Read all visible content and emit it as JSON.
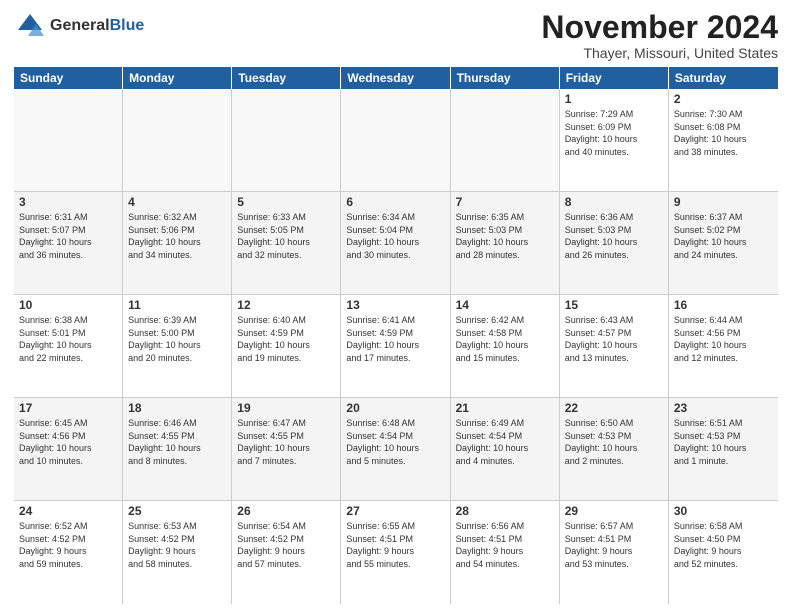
{
  "logo": {
    "general": "General",
    "blue": "Blue"
  },
  "title": "November 2024",
  "location": "Thayer, Missouri, United States",
  "weekdays": [
    "Sunday",
    "Monday",
    "Tuesday",
    "Wednesday",
    "Thursday",
    "Friday",
    "Saturday"
  ],
  "weeks": [
    [
      {
        "day": "",
        "info": "",
        "empty": true
      },
      {
        "day": "",
        "info": "",
        "empty": true
      },
      {
        "day": "",
        "info": "",
        "empty": true
      },
      {
        "day": "",
        "info": "",
        "empty": true
      },
      {
        "day": "",
        "info": "",
        "empty": true
      },
      {
        "day": "1",
        "info": "Sunrise: 7:29 AM\nSunset: 6:09 PM\nDaylight: 10 hours\nand 40 minutes."
      },
      {
        "day": "2",
        "info": "Sunrise: 7:30 AM\nSunset: 6:08 PM\nDaylight: 10 hours\nand 38 minutes."
      }
    ],
    [
      {
        "day": "3",
        "info": "Sunrise: 6:31 AM\nSunset: 5:07 PM\nDaylight: 10 hours\nand 36 minutes."
      },
      {
        "day": "4",
        "info": "Sunrise: 6:32 AM\nSunset: 5:06 PM\nDaylight: 10 hours\nand 34 minutes."
      },
      {
        "day": "5",
        "info": "Sunrise: 6:33 AM\nSunset: 5:05 PM\nDaylight: 10 hours\nand 32 minutes."
      },
      {
        "day": "6",
        "info": "Sunrise: 6:34 AM\nSunset: 5:04 PM\nDaylight: 10 hours\nand 30 minutes."
      },
      {
        "day": "7",
        "info": "Sunrise: 6:35 AM\nSunset: 5:03 PM\nDaylight: 10 hours\nand 28 minutes."
      },
      {
        "day": "8",
        "info": "Sunrise: 6:36 AM\nSunset: 5:03 PM\nDaylight: 10 hours\nand 26 minutes."
      },
      {
        "day": "9",
        "info": "Sunrise: 6:37 AM\nSunset: 5:02 PM\nDaylight: 10 hours\nand 24 minutes."
      }
    ],
    [
      {
        "day": "10",
        "info": "Sunrise: 6:38 AM\nSunset: 5:01 PM\nDaylight: 10 hours\nand 22 minutes."
      },
      {
        "day": "11",
        "info": "Sunrise: 6:39 AM\nSunset: 5:00 PM\nDaylight: 10 hours\nand 20 minutes."
      },
      {
        "day": "12",
        "info": "Sunrise: 6:40 AM\nSunset: 4:59 PM\nDaylight: 10 hours\nand 19 minutes."
      },
      {
        "day": "13",
        "info": "Sunrise: 6:41 AM\nSunset: 4:59 PM\nDaylight: 10 hours\nand 17 minutes."
      },
      {
        "day": "14",
        "info": "Sunrise: 6:42 AM\nSunset: 4:58 PM\nDaylight: 10 hours\nand 15 minutes."
      },
      {
        "day": "15",
        "info": "Sunrise: 6:43 AM\nSunset: 4:57 PM\nDaylight: 10 hours\nand 13 minutes."
      },
      {
        "day": "16",
        "info": "Sunrise: 6:44 AM\nSunset: 4:56 PM\nDaylight: 10 hours\nand 12 minutes."
      }
    ],
    [
      {
        "day": "17",
        "info": "Sunrise: 6:45 AM\nSunset: 4:56 PM\nDaylight: 10 hours\nand 10 minutes."
      },
      {
        "day": "18",
        "info": "Sunrise: 6:46 AM\nSunset: 4:55 PM\nDaylight: 10 hours\nand 8 minutes."
      },
      {
        "day": "19",
        "info": "Sunrise: 6:47 AM\nSunset: 4:55 PM\nDaylight: 10 hours\nand 7 minutes."
      },
      {
        "day": "20",
        "info": "Sunrise: 6:48 AM\nSunset: 4:54 PM\nDaylight: 10 hours\nand 5 minutes."
      },
      {
        "day": "21",
        "info": "Sunrise: 6:49 AM\nSunset: 4:54 PM\nDaylight: 10 hours\nand 4 minutes."
      },
      {
        "day": "22",
        "info": "Sunrise: 6:50 AM\nSunset: 4:53 PM\nDaylight: 10 hours\nand 2 minutes."
      },
      {
        "day": "23",
        "info": "Sunrise: 6:51 AM\nSunset: 4:53 PM\nDaylight: 10 hours\nand 1 minute."
      }
    ],
    [
      {
        "day": "24",
        "info": "Sunrise: 6:52 AM\nSunset: 4:52 PM\nDaylight: 9 hours\nand 59 minutes."
      },
      {
        "day": "25",
        "info": "Sunrise: 6:53 AM\nSunset: 4:52 PM\nDaylight: 9 hours\nand 58 minutes."
      },
      {
        "day": "26",
        "info": "Sunrise: 6:54 AM\nSunset: 4:52 PM\nDaylight: 9 hours\nand 57 minutes."
      },
      {
        "day": "27",
        "info": "Sunrise: 6:55 AM\nSunset: 4:51 PM\nDaylight: 9 hours\nand 55 minutes."
      },
      {
        "day": "28",
        "info": "Sunrise: 6:56 AM\nSunset: 4:51 PM\nDaylight: 9 hours\nand 54 minutes."
      },
      {
        "day": "29",
        "info": "Sunrise: 6:57 AM\nSunset: 4:51 PM\nDaylight: 9 hours\nand 53 minutes."
      },
      {
        "day": "30",
        "info": "Sunrise: 6:58 AM\nSunset: 4:50 PM\nDaylight: 9 hours\nand 52 minutes."
      }
    ]
  ]
}
